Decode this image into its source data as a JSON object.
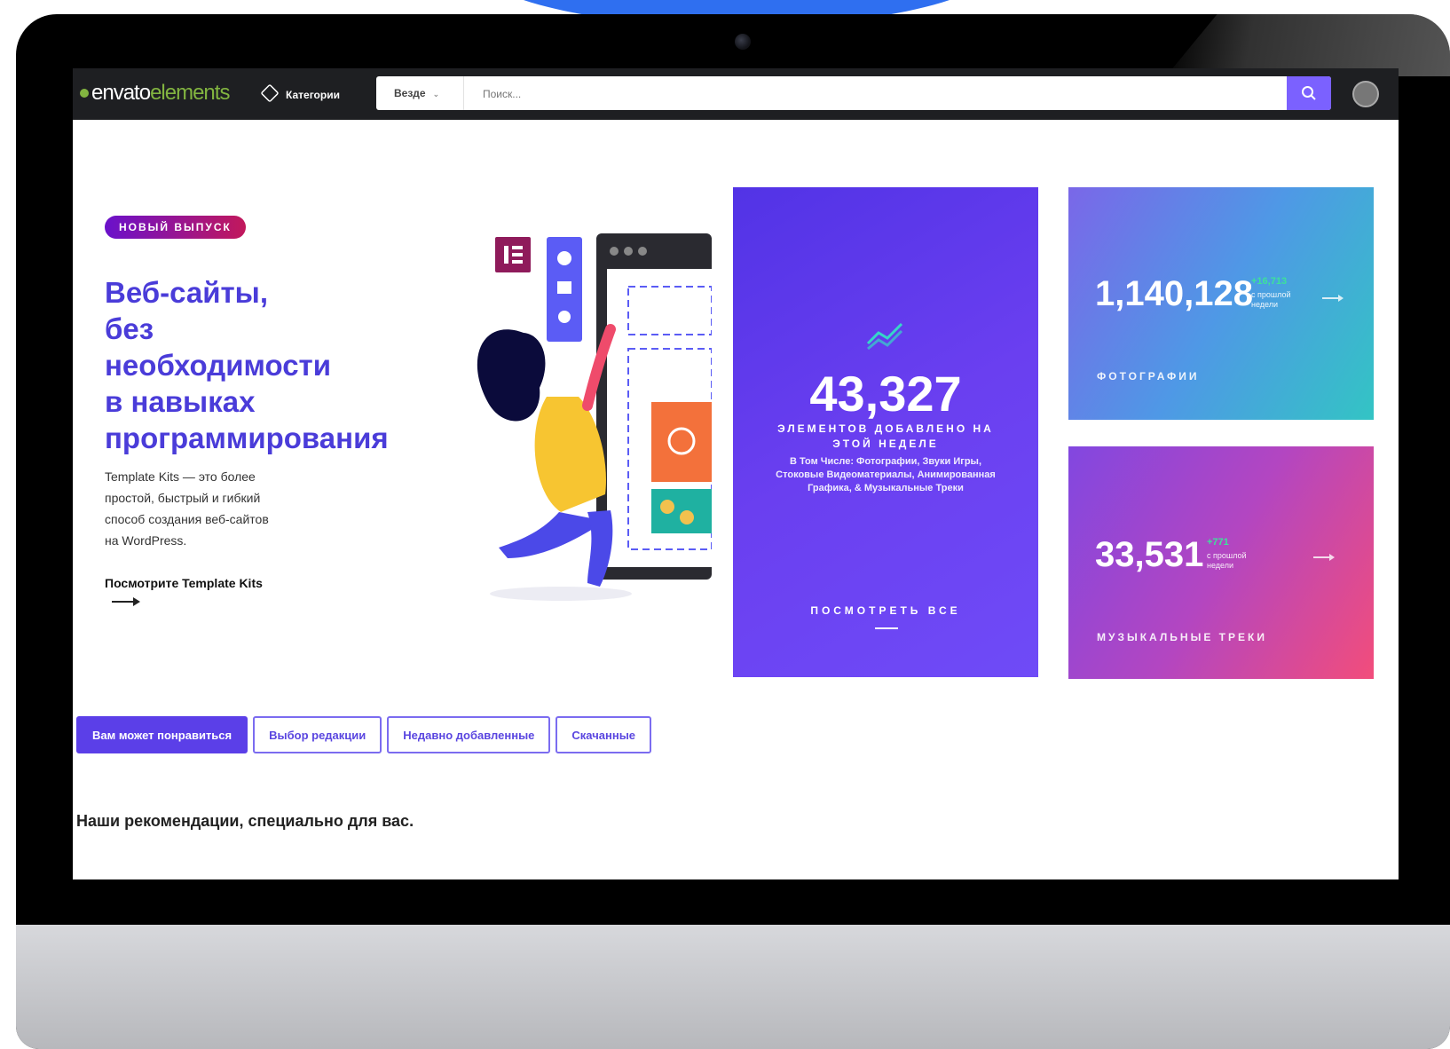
{
  "header": {
    "logo_part1": "envato",
    "logo_part2": "elements",
    "categories_label": "Категории",
    "search_scope": "Везде",
    "search_placeholder": "Поиск..."
  },
  "hero": {
    "badge": "НОВЫЙ ВЫПУСК",
    "title_lines": [
      "Веб-сайты,",
      "без",
      "необходимости",
      "в навыках",
      "программирования"
    ],
    "description_lines": [
      "Template Kits — это более",
      "простой, быстрый и гибкий",
      "способ создания веб-сайтов",
      "на WordPress."
    ],
    "link": "Посмотрите Template Kits"
  },
  "stats": {
    "main": {
      "value": "43,327",
      "label": "ЭЛЕМЕНТОВ ДОБАВЛЕНО НА ЭТОЙ НЕДЕЛЕ",
      "includes": "В Том Числе: Фотографии, Звуки Игры, Стоковые Видеоматериалы, Анимированная Графика, & Музыкальные Треки",
      "view_all": "ПОСМОТРЕТЬ ВСЕ"
    },
    "photos": {
      "value": "1,140,128",
      "delta": "+16,713",
      "since_line1": "с прошлой",
      "since_line2": "недели",
      "category": "ФОТОГРАФИИ"
    },
    "music": {
      "value": "33,531",
      "delta": "+771",
      "since_line1": "с прошлой",
      "since_line2": "недели",
      "category": "МУЗЫКАЛЬНЫЕ ТРЕКИ"
    }
  },
  "tabs": [
    {
      "label": "Вам может понравиться",
      "active": true
    },
    {
      "label": "Выбор редакции",
      "active": false
    },
    {
      "label": "Недавно добавленные",
      "active": false
    },
    {
      "label": "Скачанные",
      "active": false
    }
  ],
  "recommendations": "Наши рекомендации, специально для вас.",
  "colors": {
    "accent": "#5b3fe8",
    "brand_green": "#82b440",
    "title_blue": "#4a3cd9",
    "nav_bg": "#1e1f22"
  }
}
